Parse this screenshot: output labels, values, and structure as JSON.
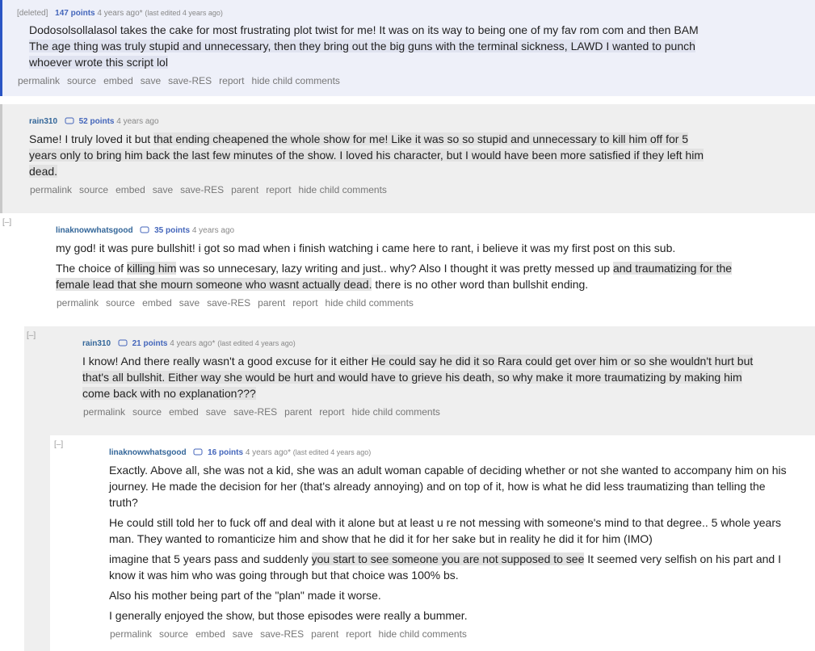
{
  "comments": [
    {
      "author": "[deleted]",
      "points": "147 points",
      "time": "4 years ago*",
      "edited": "(last edited 4 years ago)",
      "paragraphs": [
        [
          "Dodosolsollalasol takes the cake for most frustrating plot twist for me! It was on its way to being one of my fav rom com and then BAM ",
          {
            "hl": "The age thing was truly stupid and unnecessary, then they bring out the big guns with the terminal sickness, LAWD I wanted to punch whoever wrote this script lol"
          }
        ]
      ],
      "buttons": [
        "permalink",
        "source",
        "embed",
        "save",
        "save-RES",
        "report",
        "hide child comments"
      ]
    },
    {
      "author": "rain310",
      "points": "52 points",
      "time": "4 years ago",
      "edited": "",
      "paragraphs": [
        [
          "Same! I truly loved it but ",
          {
            "hl": "that ending cheapened the whole show for me! Like it was so so stupid and unnecessary to kill him off for 5 years only to bring him back the last few minutes of the show. I loved his character, but I would have been more satisfied if they left him dead."
          }
        ]
      ],
      "buttons": [
        "permalink",
        "source",
        "embed",
        "save",
        "save-RES",
        "parent",
        "report",
        "hide child comments"
      ]
    },
    {
      "author": "linaknowwhatsgood",
      "points": "35 points",
      "time": "4 years ago",
      "edited": "",
      "paragraphs": [
        [
          "my god! it was pure bullshit! i got so mad when i finish watching i came here to rant, i believe it was my first post on this sub."
        ],
        [
          "The choice of ",
          {
            "hl": "killing him"
          },
          " was so unnecesary, lazy writing and just.. why? Also I thought it was pretty messed up ",
          {
            "hl": "and traumatizing for the female lead that she mourn someone who wasnt actually dead."
          },
          " there is no other word than bullshit ending."
        ]
      ],
      "buttons": [
        "permalink",
        "source",
        "embed",
        "save",
        "save-RES",
        "parent",
        "report",
        "hide child comments"
      ]
    },
    {
      "author": "rain310",
      "points": "21 points",
      "time": "4 years ago*",
      "edited": "(last edited 4 years ago)",
      "paragraphs": [
        [
          "I know! And there really wasn't a good excuse for it either ",
          {
            "hl": "He could say he did it so Rara could get over him or so she wouldn't hurt but that's all bullshit. Either way she would be hurt and would have to grieve his death, so why make it more traumatizing by making him come back with no explanation???"
          }
        ]
      ],
      "buttons": [
        "permalink",
        "source",
        "embed",
        "save",
        "save-RES",
        "parent",
        "report",
        "hide child comments"
      ]
    },
    {
      "author": "linaknowwhatsgood",
      "points": "16 points",
      "time": "4 years ago*",
      "edited": "(last edited 4 years ago)",
      "paragraphs": [
        [
          "Exactly. Above all, she was not a kid, she was an adult woman capable of deciding whether or not she wanted to accompany him on his journey. He made the decision for her (that's already annoying) and on top of it, how is what he did less traumatizing than telling the truth?"
        ],
        [
          "He could still told her to fuck off and deal with it alone but at least u re not messing with someone's mind to that degree.. 5 whole years man. They wanted to romanticize him and show that he did it for her sake but in reality he did it for him (IMO)"
        ],
        [
          "imagine that 5 years pass and suddenly ",
          {
            "hl": "you start to see someone you are not supposed to see"
          },
          " It seemed very selfish on his part and I know it was him who was going through but that choice was 100% bs."
        ],
        [
          "Also his mother being part of the \"plan\" made it worse."
        ],
        [
          "I generally enjoyed the show, but those episodes were really a bummer."
        ]
      ],
      "buttons": [
        "permalink",
        "source",
        "embed",
        "save",
        "save-RES",
        "parent",
        "report",
        "hide child comments"
      ]
    }
  ],
  "collapse_label": "[–]",
  "colors": {
    "accent": "#2b55c4",
    "author": "#336699",
    "points": "#4466bb"
  }
}
